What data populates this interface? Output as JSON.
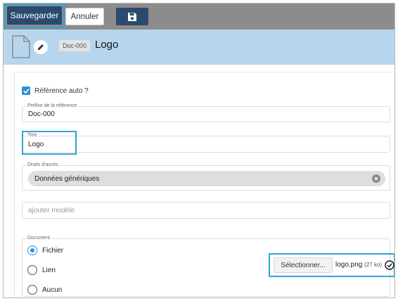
{
  "toolbar": {
    "save_label": "Sauvegarder",
    "cancel_label": "Annuler",
    "save_icon": "floppy-disk-icon",
    "highlight_color": "#2ea3d8",
    "primary_color": "#2b4a6e"
  },
  "header": {
    "doc_icon": "document-icon",
    "edit_icon": "pencil-icon",
    "badge": "Doc-000",
    "title": "Logo",
    "background": "#b7d6ee"
  },
  "form": {
    "auto_ref": {
      "label": "Référence auto ?",
      "checked": true
    },
    "prefix": {
      "label": "Préfixe de la référence",
      "value": "Doc-000"
    },
    "title": {
      "label": "Titre",
      "value": "Logo"
    },
    "access": {
      "label": "Droits d'accès",
      "chip": "Données génériques",
      "chip_close_icon": "close-circle-icon"
    },
    "template": {
      "placeholder": "ajouter modèle"
    },
    "document": {
      "label": "Document",
      "options": [
        {
          "label": "Fichier",
          "selected": true
        },
        {
          "label": "Lien",
          "selected": false
        },
        {
          "label": "Aucun",
          "selected": false
        }
      ],
      "select_label": "Sélectionner...",
      "file_name": "logo.png",
      "file_size": "(27 ko)",
      "file_status_icon": "check-circle-icon"
    }
  }
}
